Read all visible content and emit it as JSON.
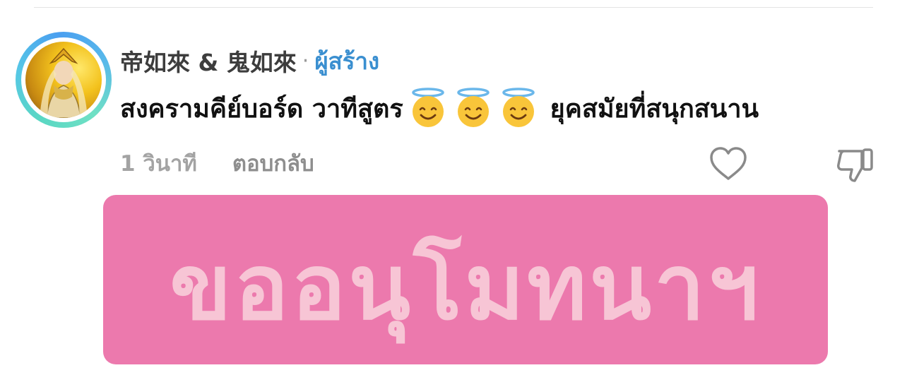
{
  "comment": {
    "author_name": "帝如來 & 鬼如來",
    "separator": "·",
    "creator_badge": "ผู้สร้าง",
    "text_before": "สงครามคีย์บอร์ด วาทีสูตร",
    "emojis": [
      "smiling-face-with-halo",
      "smiling-face-with-halo",
      "smiling-face-with-halo"
    ],
    "text_after": "ยุคสมัยที่สนุกสนาน",
    "timestamp": "1 วินาที",
    "reply_label": "ตอบกลับ",
    "sticker_text": "ขออนุโมทนาฯ"
  },
  "colors": {
    "creator_badge": "#3a8fd0",
    "sticker_background": "#ec79ad",
    "sticker_text": "#f7c5d5",
    "avatar_ring": "#56c7e6"
  }
}
